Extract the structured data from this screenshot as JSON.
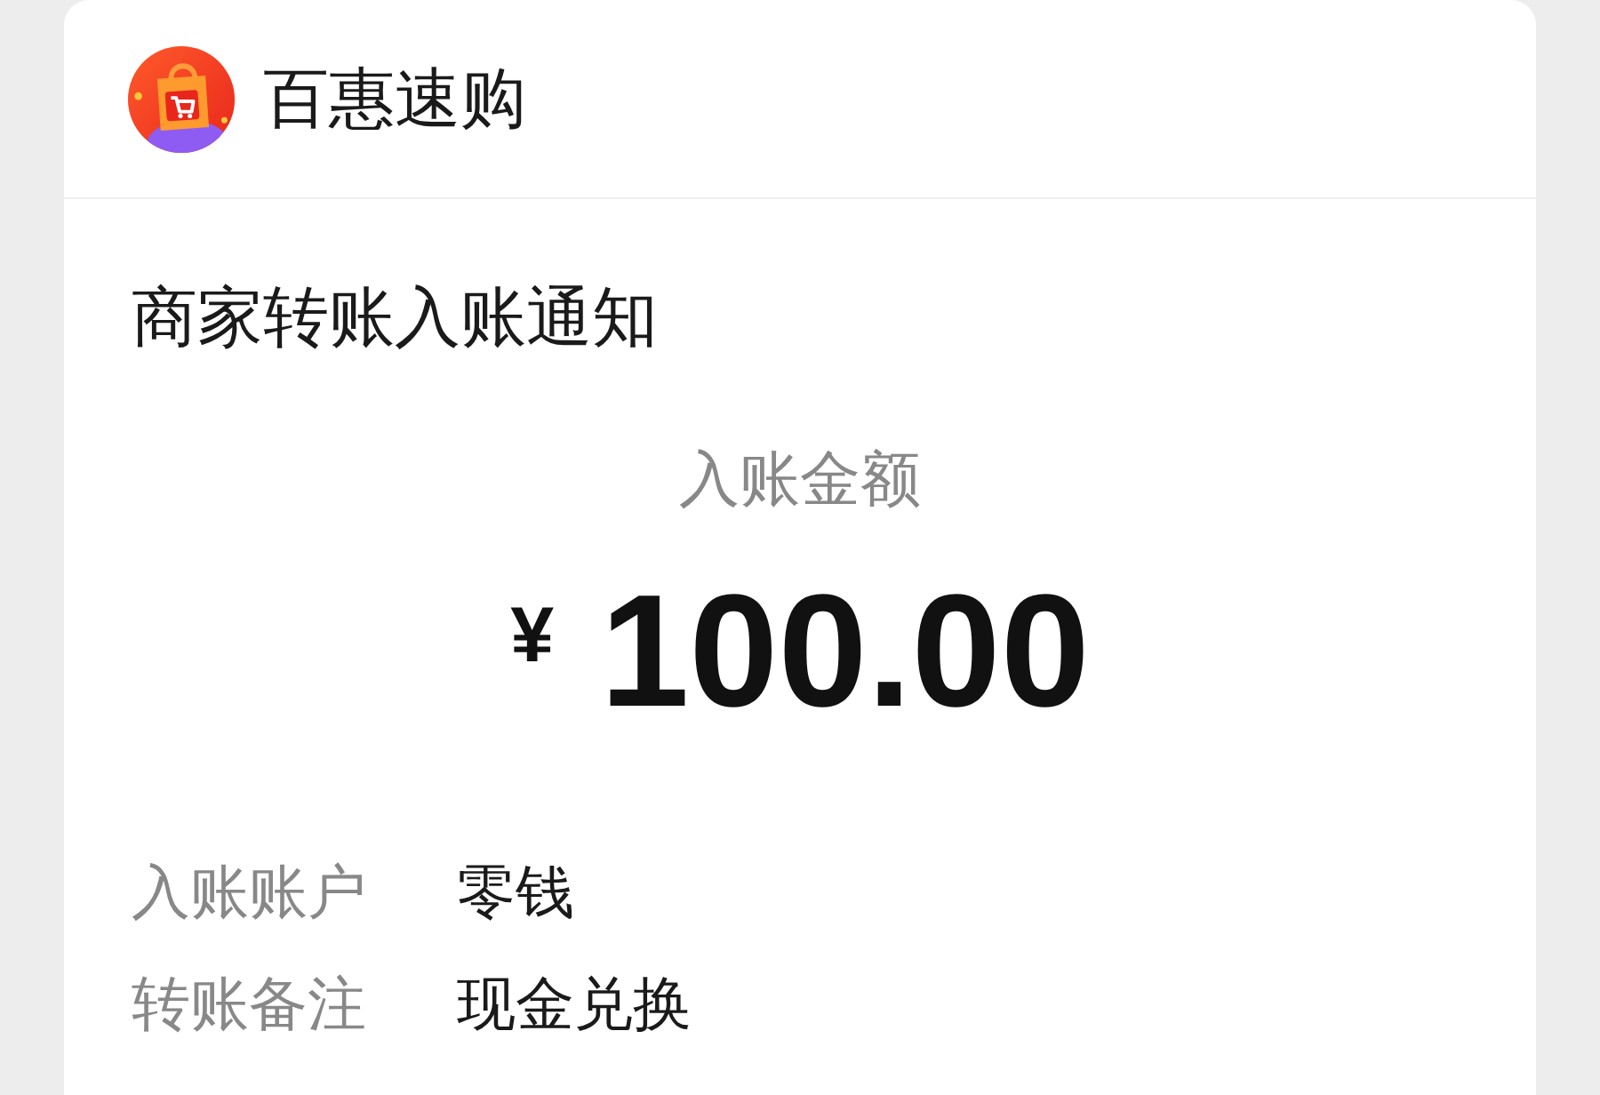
{
  "app": {
    "name": "百惠速购"
  },
  "notice": {
    "title": "商家转账入账通知",
    "amount_label": "入账金额",
    "currency": "¥",
    "amount": "100.00"
  },
  "details": [
    {
      "label": "入账账户",
      "value": "零钱"
    },
    {
      "label": "转账备注",
      "value": "现金兑换"
    }
  ]
}
